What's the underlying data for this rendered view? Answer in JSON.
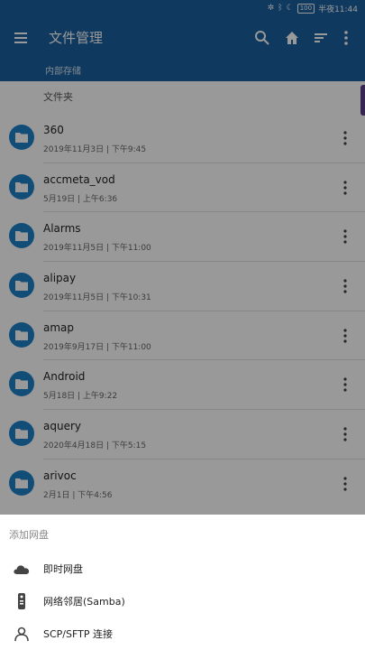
{
  "status_bar": {
    "time": "半夜11:44",
    "battery": "100"
  },
  "app_bar": {
    "title": "文件管理",
    "subtitle": "内部存储",
    "icons": [
      "menu-icon",
      "search-icon",
      "home-icon",
      "sort-icon",
      "more-vert-icon"
    ]
  },
  "section_header": "文件夹",
  "files": [
    {
      "name": "360",
      "meta": "2019年11月3日 | 下午9:45"
    },
    {
      "name": "accmeta_vod",
      "meta": "5月19日 | 上午6:36"
    },
    {
      "name": "Alarms",
      "meta": "2019年11月5日 | 下午11:00"
    },
    {
      "name": "alipay",
      "meta": "2019年11月5日 | 下午10:31"
    },
    {
      "name": "amap",
      "meta": "2019年9月17日 | 下午11:00"
    },
    {
      "name": "Android",
      "meta": "5月18日 | 上午9:22"
    },
    {
      "name": "aquery",
      "meta": "2020年4月18日 | 下午5:15"
    },
    {
      "name": "arivoc",
      "meta": "2月1日 | 下午4:56"
    }
  ],
  "bottom_sheet": {
    "title": "添加网盘",
    "options": [
      {
        "label": "即时网盘",
        "icon": "cloud-icon"
      },
      {
        "label": "网络邻居(Samba)",
        "icon": "network-device-icon"
      },
      {
        "label": "SCP/SFTP 连接",
        "icon": "sftp-user-icon"
      }
    ]
  },
  "colors": {
    "primary": "#1a5f9e",
    "folder": "#1e80c8",
    "scroll_handle": "#5b3c8a"
  }
}
